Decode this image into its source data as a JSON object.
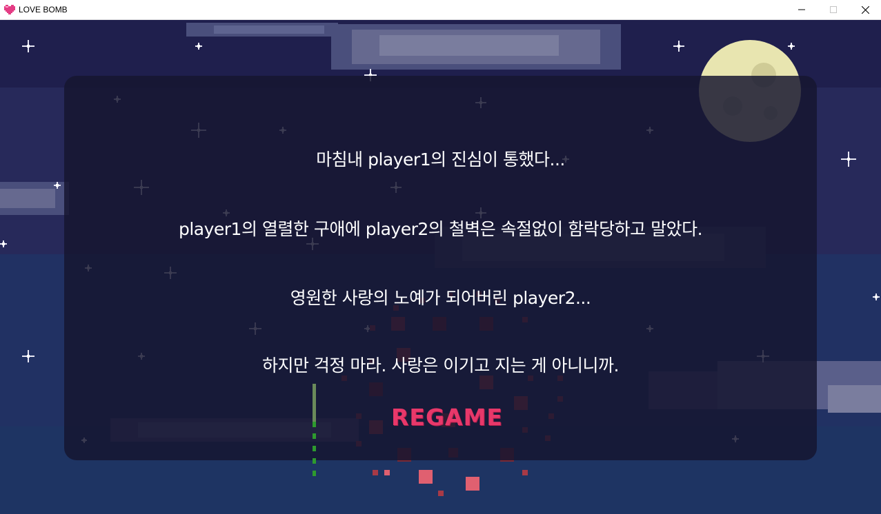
{
  "window": {
    "title": "LOVE BOMB",
    "icon": "pixel-heart-icon",
    "controls": {
      "minimize": "minimize-icon",
      "maximize": "maximize-icon",
      "close": "close-icon"
    }
  },
  "ending": {
    "lines": [
      "마침내 player1의 진심이 통했다...",
      "player1의 열렬한 구애에 player2의 철벽은 속절없이 함락당하고 말았다.",
      "영원한 사랑의 노예가 되어버린 player2...",
      "하지만 걱정 마라. 사랑은 이기고 지는 게 아니니까."
    ],
    "regame_label": "REGAME"
  },
  "colors": {
    "regame": "#e8386a",
    "text": "#ffffff",
    "sky": "#1f1f4d",
    "moon": "#e8e5b0",
    "firework": "#b84048"
  }
}
